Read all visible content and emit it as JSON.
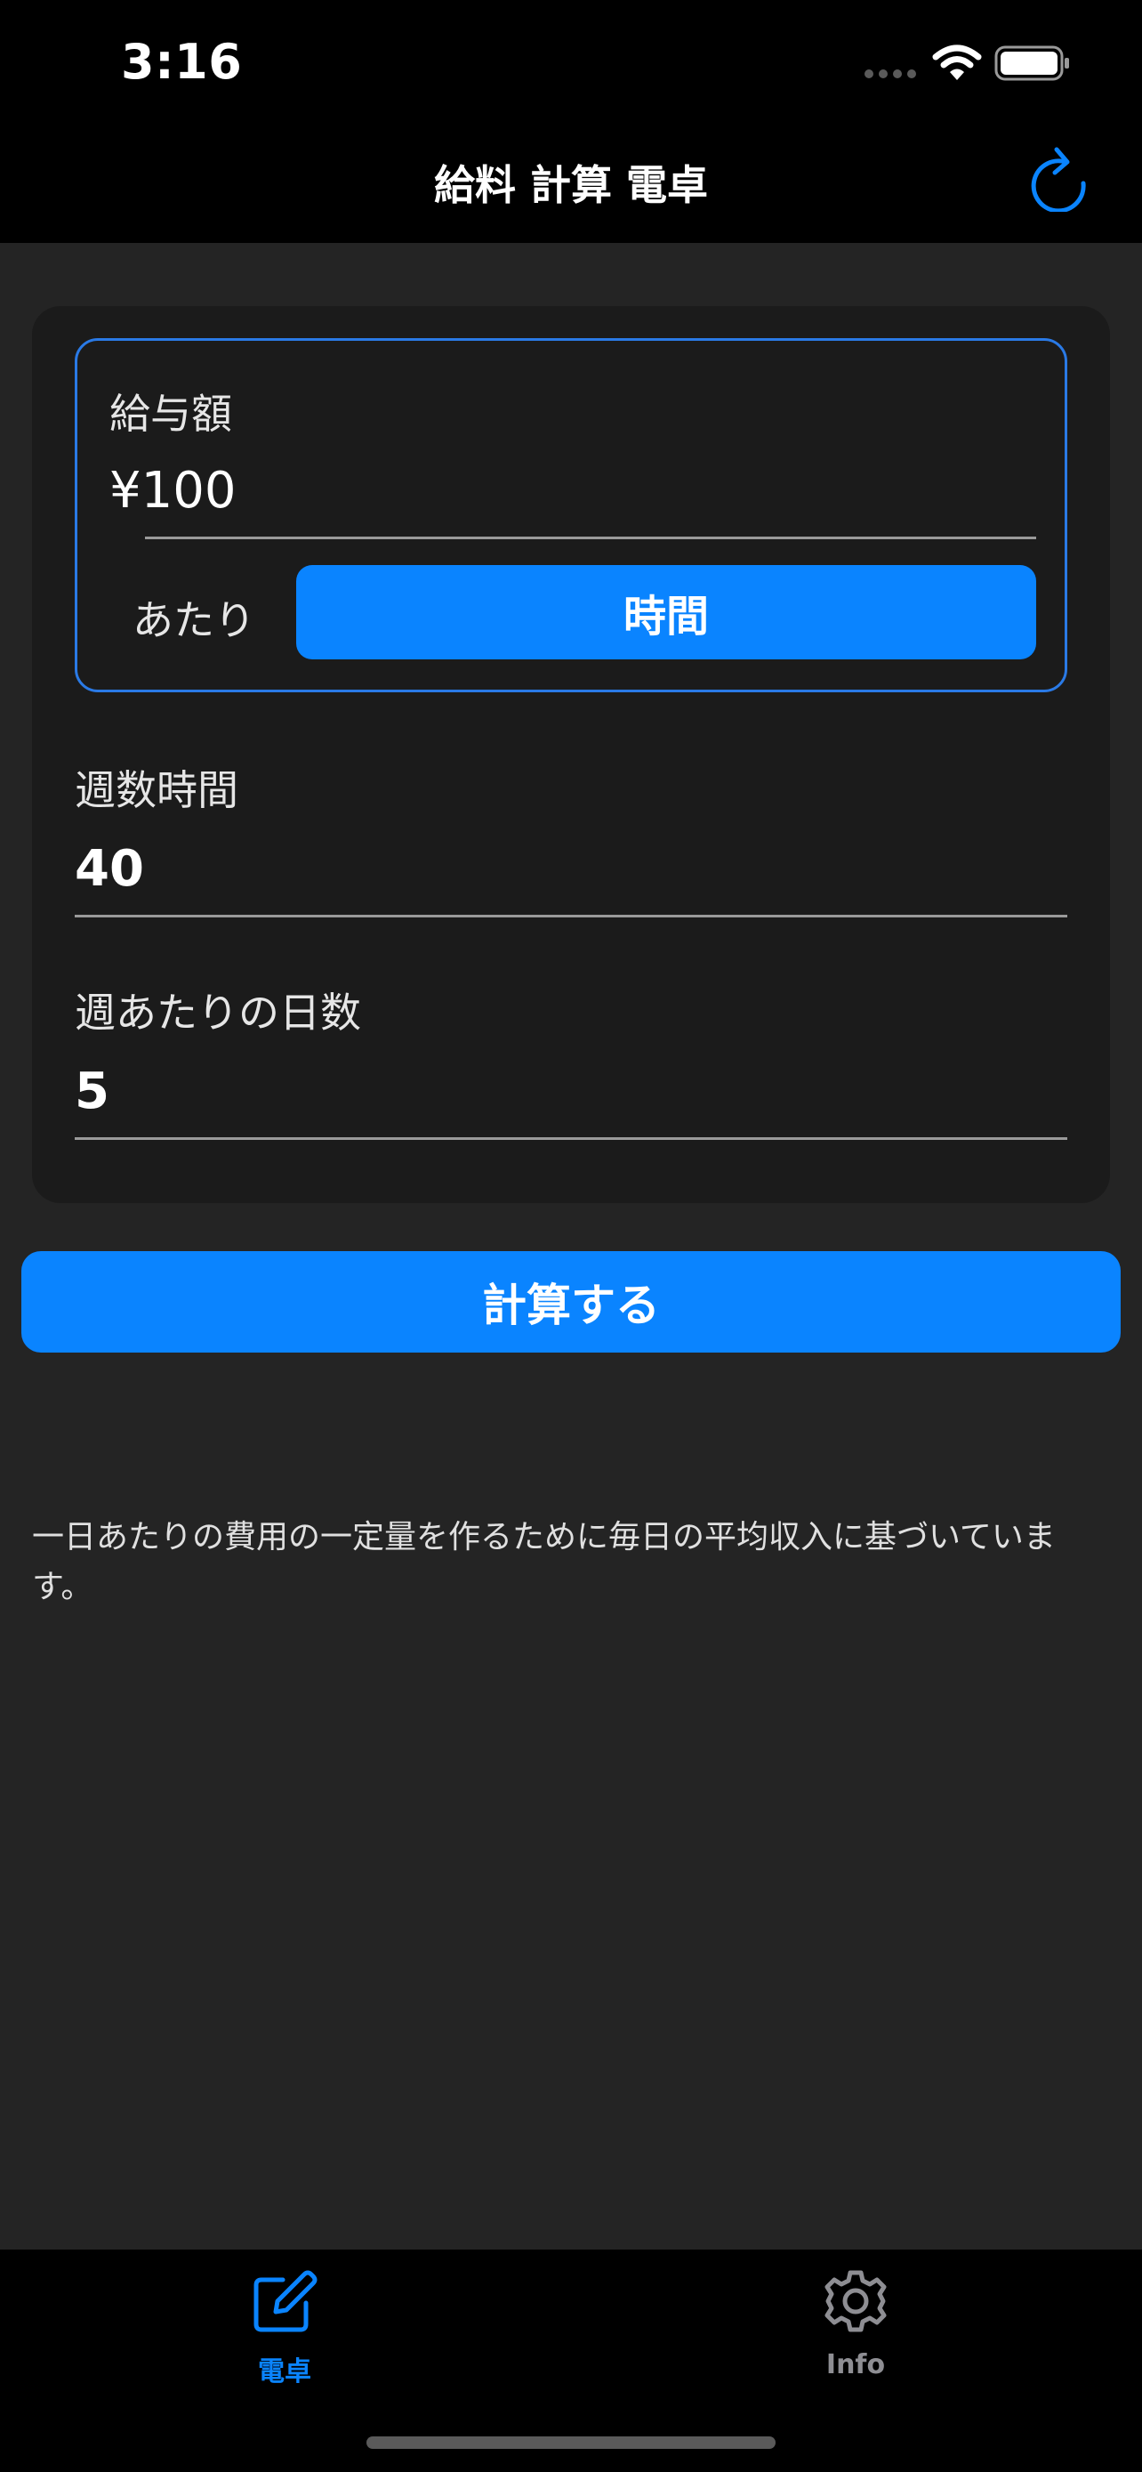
{
  "status_bar": {
    "time": "3:16"
  },
  "nav": {
    "title": "給料 計算 電卓",
    "refresh_icon": "refresh-icon"
  },
  "form": {
    "wage": {
      "label": "給与額",
      "value": "¥100",
      "per_label": "あたり",
      "unit_button": "時間"
    },
    "weekly_hours": {
      "label": "週数時間",
      "value": "40"
    },
    "days_per_week": {
      "label": "週あたりの日数",
      "value": "5"
    }
  },
  "calculate_button": "計算する",
  "note": "一日あたりの費用の一定量を作るために毎日の平均収入に基づいています。",
  "tabs": [
    {
      "label": "電卓",
      "icon": "pencil-square-icon",
      "selected": true
    },
    {
      "label": "Info",
      "icon": "gear-icon",
      "selected": false
    }
  ],
  "colors": {
    "accent": "#0a84ff",
    "background": "#242424",
    "card": "#1b1b1b",
    "bar": "#000000"
  }
}
